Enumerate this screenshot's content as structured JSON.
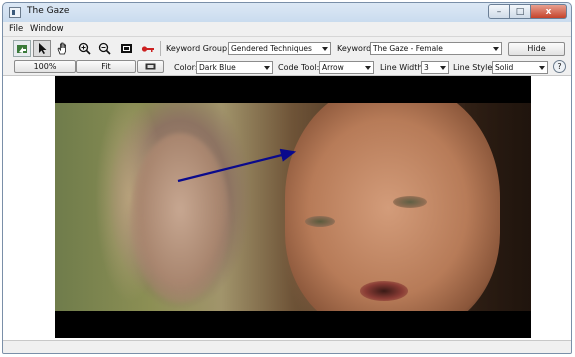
{
  "window": {
    "title": "The Gaze",
    "controls": {
      "minimize": "–",
      "maximize": "□",
      "close": "x"
    }
  },
  "menu": {
    "file": "File",
    "window": "Window"
  },
  "toolbar": {
    "tools": [
      {
        "name": "export-icon"
      },
      {
        "name": "arrow-pointer-icon",
        "selected": true
      },
      {
        "name": "hand-pan-icon"
      },
      {
        "name": "zoom-in-icon"
      },
      {
        "name": "zoom-out-icon"
      },
      {
        "name": "fit-screen-icon"
      },
      {
        "name": "key-icon",
        "color": "#cc2020"
      }
    ],
    "keyword_group_label": "Keyword Group:",
    "keyword_group_value": "Gendered Techniques",
    "keyword_label": "Keyword:",
    "keyword_value": "The Gaze - Female",
    "hide_button": "Hide"
  },
  "toolbar2": {
    "zoom_button": "100%",
    "fit_button": "Fit",
    "color_label": "Color:",
    "color_value": "Dark Blue",
    "code_tool_label": "Code Tool:",
    "code_tool_value": "Arrow",
    "line_width_label": "Line Width:",
    "line_width_value": "3",
    "line_style_label": "Line Style:",
    "line_style_value": "Solid",
    "help": "?"
  },
  "annotation": {
    "color": "#0a0a8c"
  }
}
